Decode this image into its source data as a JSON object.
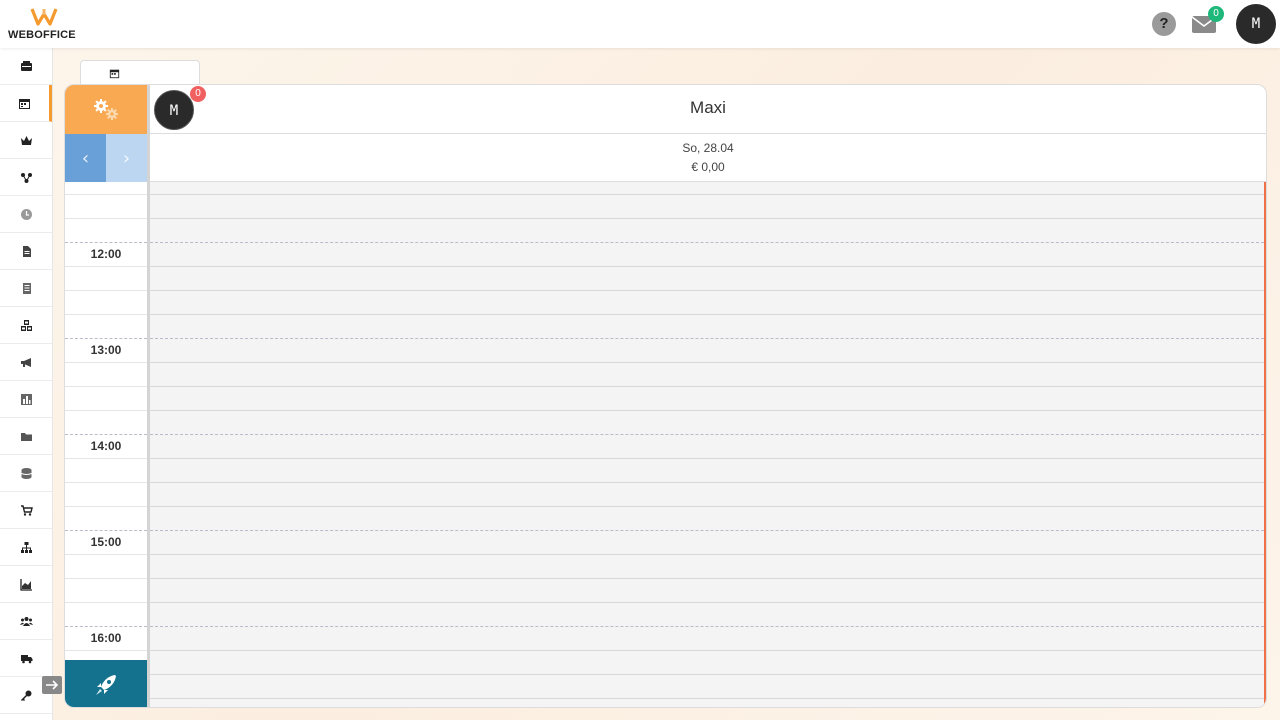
{
  "brand": {
    "name": "WEBOFFICE",
    "accent": "#f59a2e"
  },
  "header": {
    "help_label": "?",
    "mail_count": "0",
    "user_initial": "M"
  },
  "sidebar": {
    "items": [
      {
        "icon": "cash-register-icon"
      },
      {
        "icon": "calendar-icon",
        "active": true
      },
      {
        "icon": "crown-icon"
      },
      {
        "icon": "network-icon"
      },
      {
        "icon": "clock-icon"
      },
      {
        "icon": "document-icon"
      },
      {
        "icon": "list-document-icon"
      },
      {
        "icon": "boxes-icon"
      },
      {
        "icon": "megaphone-icon"
      },
      {
        "icon": "bar-chart-icon"
      },
      {
        "icon": "folder-icon"
      },
      {
        "icon": "database-icon"
      },
      {
        "icon": "cart-icon"
      },
      {
        "icon": "hierarchy-icon"
      },
      {
        "icon": "area-chart-icon"
      },
      {
        "icon": "users-icon"
      },
      {
        "icon": "truck-icon"
      },
      {
        "icon": "key-icon"
      }
    ]
  },
  "calendar": {
    "staff": {
      "initial": "M",
      "badge": "0",
      "name": "Maxi"
    },
    "day": {
      "date": "So, 28.04",
      "total": "€ 0,00"
    },
    "hour_labels": [
      "12:00",
      "13:00",
      "14:00",
      "15:00",
      "16:00"
    ],
    "prev_label": "‹",
    "next_label": "›"
  }
}
